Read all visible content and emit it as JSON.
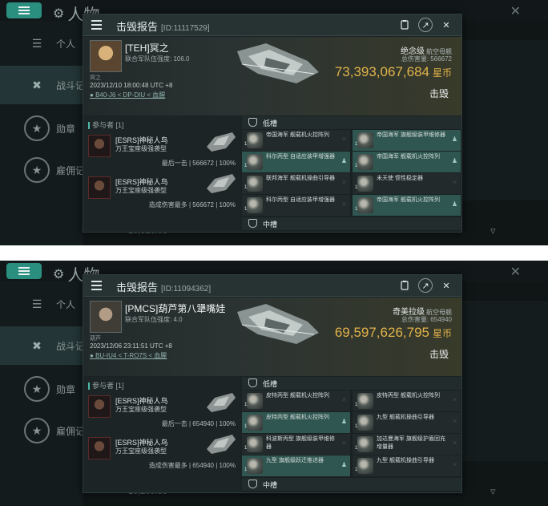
{
  "screenshots": [
    {
      "background": {
        "title": "人物",
        "sidebar": [
          {
            "label": "个人"
          },
          {
            "label": "战斗记"
          },
          {
            "label": "勋章"
          },
          {
            "label": "雇佣记"
          }
        ],
        "bottom_text": "10,016.00"
      },
      "report": {
        "title": "击毁报告",
        "id": "[ID:11117529]",
        "victim": {
          "name": "[TEH]冥之",
          "security_status": "联合军队伍强度: 106.0",
          "corp": "冥之",
          "time": "2023/12/10 18:00:48 UTC +8",
          "location": "B40-J6 < DP-DIU < 血腥",
          "ship_name": "绝念级",
          "ship_class": "航空母舰",
          "damage_taken": "总伤害量: 566672",
          "isk_value": "73,393,067,684",
          "isk_unit": "星币",
          "status": "击毁"
        },
        "attackers_header": "参与者 [1]",
        "attackers": [
          {
            "name": "[ESRS]神秘人鸟",
            "ship": "万王宝座级强袭型",
            "note": "最后一击",
            "damage": "566672",
            "percent": "100%"
          },
          {
            "name": "[ESRS]神秘人鸟",
            "ship": "万王宝座级强袭型",
            "note": "造成伤害最多",
            "damage": "566672",
            "percent": "100%"
          }
        ],
        "slots": [
          {
            "title": "低槽",
            "left": [
              {
                "qty": "1",
                "name": "帝国海军 舰载机火控阵列",
                "highlight": false,
                "status": "x"
              },
              {
                "qty": "1",
                "name": "科尔丙型 自适应装甲增强器",
                "highlight": true,
                "status": "person"
              },
              {
                "qty": "1",
                "name": "联邦海军 舰载机操曲引导器",
                "highlight": false,
                "status": "x"
              },
              {
                "qty": "1",
                "name": "科尔丙型 自适应装甲增强器",
                "highlight": false,
                "status": "x"
              }
            ],
            "right": [
              {
                "qty": "1",
                "name": "帝国海军 旗舰级装甲维修器",
                "highlight": true,
                "status": "person"
              },
              {
                "qty": "1",
                "name": "帝国海军 舰载机火控阵列",
                "highlight": true,
                "status": "person"
              },
              {
                "qty": "1",
                "name": "未天使 惯性稳定器",
                "highlight": false,
                "status": "x"
              },
              {
                "qty": "1",
                "name": "帝国海军 舰载机火控阵列",
                "highlight": true,
                "status": "person"
              }
            ]
          },
          {
            "title": "中槽"
          }
        ]
      }
    },
    {
      "background": {
        "title": "人物",
        "sidebar": [
          {
            "label": "个人"
          },
          {
            "label": "战斗记"
          },
          {
            "label": "勋章"
          },
          {
            "label": "雇佣记"
          }
        ],
        "bottom_text": "10,209.55"
      },
      "report": {
        "title": "击毁报告",
        "id": "[ID:11094362]",
        "victim": {
          "name": "[PMCS]葫芦第八犟嘴娃",
          "security_status": "联合军队伍强度: 4.0",
          "corp": "葫芦",
          "time": "2023/12/06 23:11:51 UTC +8",
          "location": "BU-IU4 < T-RO7S < 血腥",
          "ship_name": "奇美拉级",
          "ship_class": "航空母舰",
          "damage_taken": "总伤害量: 654940",
          "isk_value": "69,597,626,795",
          "isk_unit": "星币",
          "status": "击毁"
        },
        "attackers_header": "参与者 [1]",
        "attackers": [
          {
            "name": "[ESRS]神秘人鸟",
            "ship": "万王宝座级强袭型",
            "note": "最后一击",
            "damage": "654940",
            "percent": "100%"
          },
          {
            "name": "[ESRS]神秘人鸟",
            "ship": "万王宝座级强袭型",
            "note": "造成伤害最多",
            "damage": "654940",
            "percent": "100%"
          }
        ],
        "slots": [
          {
            "title": "低槽",
            "left": [
              {
                "qty": "1",
                "name": "皮特丙型 舰载机火控阵列",
                "highlight": false,
                "status": "x"
              },
              {
                "qty": "1",
                "name": "皮特丙型 舰载机火控阵列",
                "highlight": true,
                "status": "person"
              },
              {
                "qty": "1",
                "name": "科波斯丙型 旗舰级装甲维修器",
                "highlight": false,
                "status": "x"
              },
              {
                "qty": "1",
                "name": "九型 旗舰级跃迁推进器",
                "highlight": true,
                "status": "person"
              }
            ],
            "right": [
              {
                "qty": "1",
                "name": "皮特丙型 舰载机火控阵列",
                "highlight": false,
                "status": "x"
              },
              {
                "qty": "1",
                "name": "九型 舰载机操曲引导器",
                "highlight": false,
                "status": "x"
              },
              {
                "qty": "1",
                "name": "加达曼海军 旗舰级护盾回充增量器",
                "highlight": false,
                "status": "x"
              },
              {
                "qty": "1",
                "name": "九型 舰载机操曲引导器",
                "highlight": false,
                "status": "x"
              }
            ]
          },
          {
            "title": "中槽"
          }
        ]
      }
    }
  ]
}
